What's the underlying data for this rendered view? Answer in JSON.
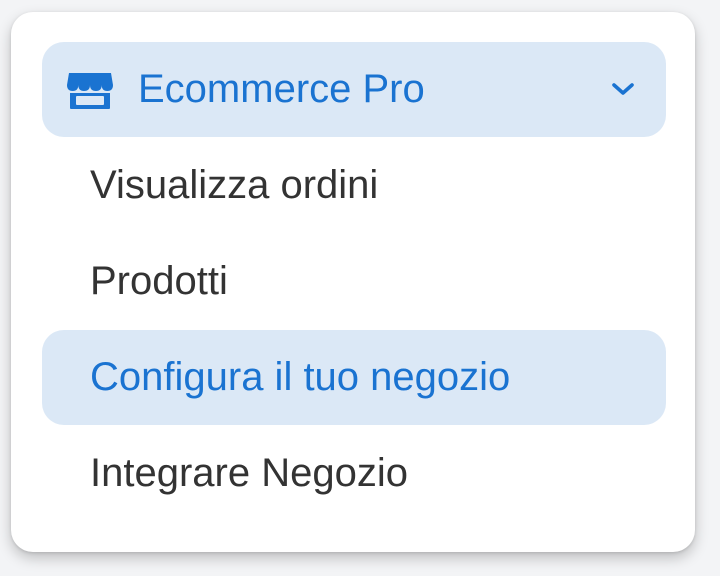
{
  "menu": {
    "header": {
      "title": "Ecommerce Pro",
      "icon": "store-icon",
      "expand_icon": "chevron-down-icon",
      "expanded": true
    },
    "items": [
      {
        "label": "Visualizza ordini",
        "active": false
      },
      {
        "label": "Prodotti",
        "active": false
      },
      {
        "label": "Configura il tuo negozio",
        "active": true
      },
      {
        "label": "Integrare Negozio",
        "active": false
      }
    ]
  },
  "colors": {
    "accent": "#1a73d1",
    "highlight_bg": "#dbe8f6",
    "text": "#333333",
    "panel_bg": "#ffffff"
  }
}
